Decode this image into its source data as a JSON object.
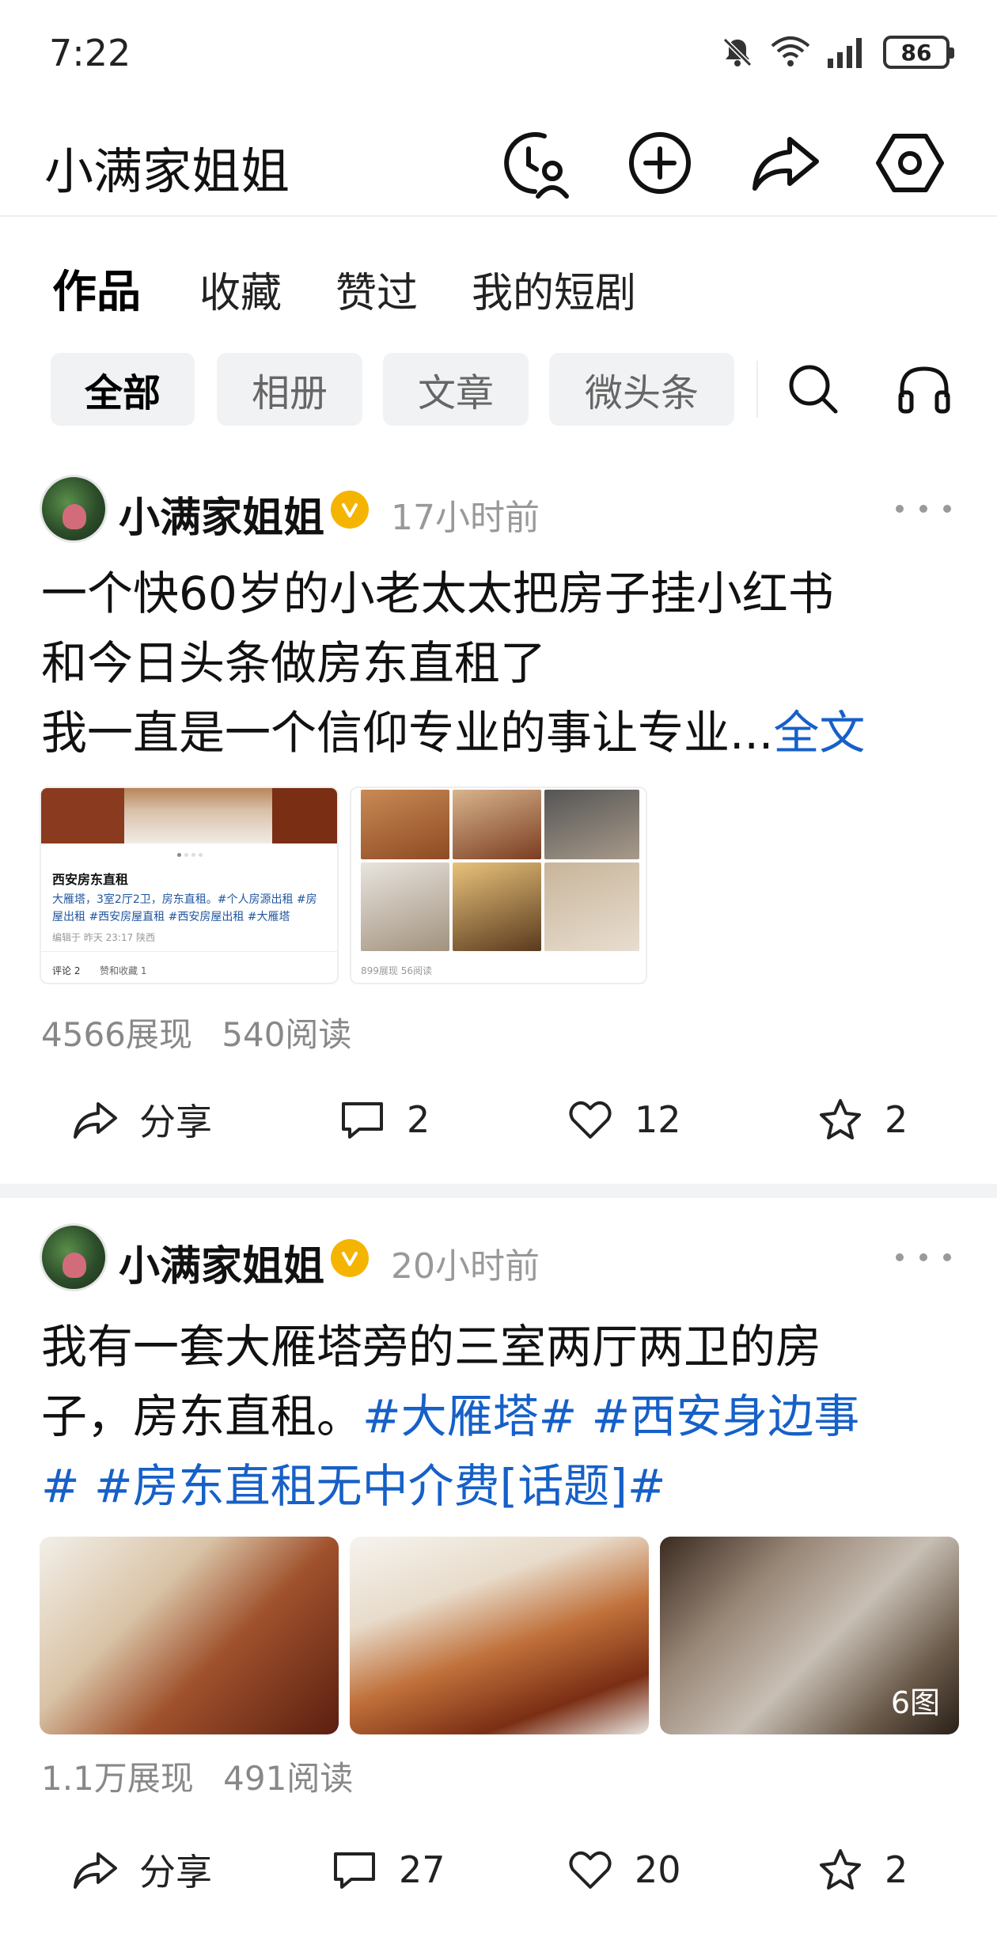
{
  "status_bar": {
    "time": "7:22",
    "battery": "86"
  },
  "header": {
    "title": "小满家姐姐",
    "icons": [
      "history-user-icon",
      "add-icon",
      "share-icon",
      "settings-icon"
    ]
  },
  "tabs": [
    {
      "label": "作品",
      "active": true
    },
    {
      "label": "收藏",
      "active": false
    },
    {
      "label": "赞过",
      "active": false
    },
    {
      "label": "我的短剧",
      "active": false
    }
  ],
  "filters": [
    {
      "label": "全部",
      "active": true
    },
    {
      "label": "相册",
      "active": false
    },
    {
      "label": "文章",
      "active": false
    },
    {
      "label": "微头条",
      "active": false
    }
  ],
  "posts": [
    {
      "author": "小满家姐姐",
      "time": "17小时前",
      "text_line1": "一个快60岁的小老太太把房子挂小红书",
      "text_line2": "和今日头条做房东直租了",
      "text_line3": "我一直是一个信仰专业的事让专业...",
      "full_text_link": "全文",
      "thumb_doc": {
        "title": "西安房东直租",
        "body_line1": "大雁塔，3室2厅2卫，房东直租。#个人房源出租 #房",
        "body_line2": "屋出租 #西安房屋直租 #西安房屋出租 #大雁塔",
        "edited": "编辑于 昨天 23:17 陕西",
        "footer_comment": "评论 2",
        "footer_fav": "赞和收藏 1"
      },
      "thumb_grid_stats": "899展现  56阅读",
      "impressions": "4566展现",
      "reads": "540阅读",
      "share_label": "分享",
      "comments": "2",
      "likes": "12",
      "favorites": "2"
    },
    {
      "author": "小满家姐姐",
      "time": "20小时前",
      "text_line1": "我有一套大雁塔旁的三室两厅两卫的房",
      "text_line2_plain": "子，房东直租。",
      "text_line2_tags": "#大雁塔# #西安身边事",
      "text_line3_tags": "# #房东直租无中介费[话题]#",
      "photo_count": "6图",
      "impressions": "1.1万展现",
      "reads": "491阅读",
      "share_label": "分享",
      "comments": "27",
      "likes": "20",
      "favorites": "2"
    }
  ],
  "colors": {
    "link": "#1660c8",
    "verified": "#f5b400",
    "muted": "#888888",
    "chip_bg": "#f1f2f4"
  }
}
